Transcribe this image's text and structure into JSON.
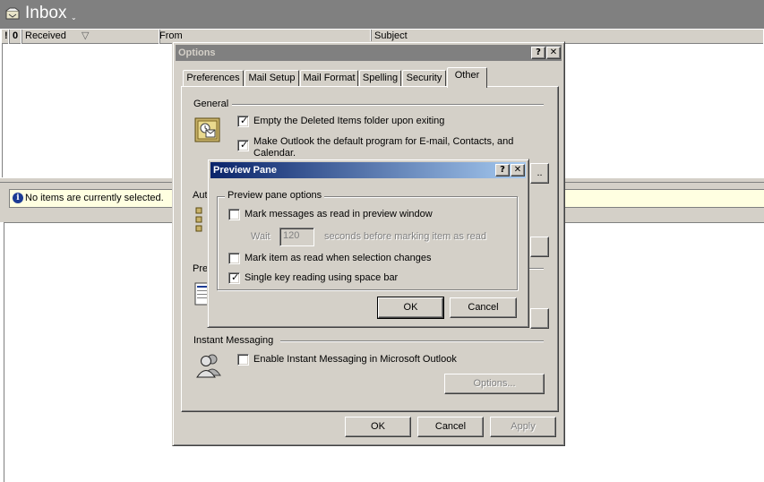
{
  "inbox": {
    "title": "Inbox",
    "caret": "⌄",
    "columns": {
      "importance": "!",
      "attachment": "0",
      "received": "Received",
      "sort_indicator": "▽",
      "from": "From",
      "subject": "Subject"
    },
    "info_icon": "i",
    "info_text": "No items are currently selected."
  },
  "options_dialog": {
    "title": "Options",
    "help_glyph": "?",
    "close_glyph": "✕",
    "tabs": [
      "Preferences",
      "Mail Setup",
      "Mail Format",
      "Spelling",
      "Security",
      "Other"
    ],
    "active_tab": "Other",
    "general_label": "General",
    "empty_deleted_label": "Empty the Deleted Items folder upon exiting",
    "empty_deleted_checked": true,
    "default_program_label_1": "Make Outlook the default program for E-mail, Contacts, and",
    "default_program_label_2": "Calendar.",
    "default_program_checked": true,
    "partial_button_text": "..",
    "auto_label_partial": "Aut",
    "preview_label_partial": "Pre",
    "instant_messaging_label": "Instant Messaging",
    "enable_im_label": "Enable Instant Messaging in Microsoft Outlook",
    "enable_im_checked": false,
    "im_options_button": "Options...",
    "ok_button": "OK",
    "cancel_button": "Cancel",
    "apply_button": "Apply"
  },
  "preview_dialog": {
    "title": "Preview Pane",
    "help_glyph": "?",
    "close_glyph": "✕",
    "group_label": "Preview pane options",
    "mark_read_label": "Mark messages as read in preview window",
    "mark_read_checked": false,
    "wait_label": "Wait",
    "wait_value": "120",
    "seconds_label": "seconds before marking item as read",
    "mark_selection_label": "Mark item as read when selection changes",
    "mark_selection_checked": false,
    "single_key_label": "Single key reading using space bar",
    "single_key_checked": true,
    "ok_button": "OK",
    "cancel_button": "Cancel"
  },
  "colors": {
    "dialog_face": "#d4d0c8",
    "active_title_start": "#0a246a",
    "active_title_end": "#a6caf0",
    "inactive_title": "#808080",
    "info_bar": "#ffffe1"
  }
}
